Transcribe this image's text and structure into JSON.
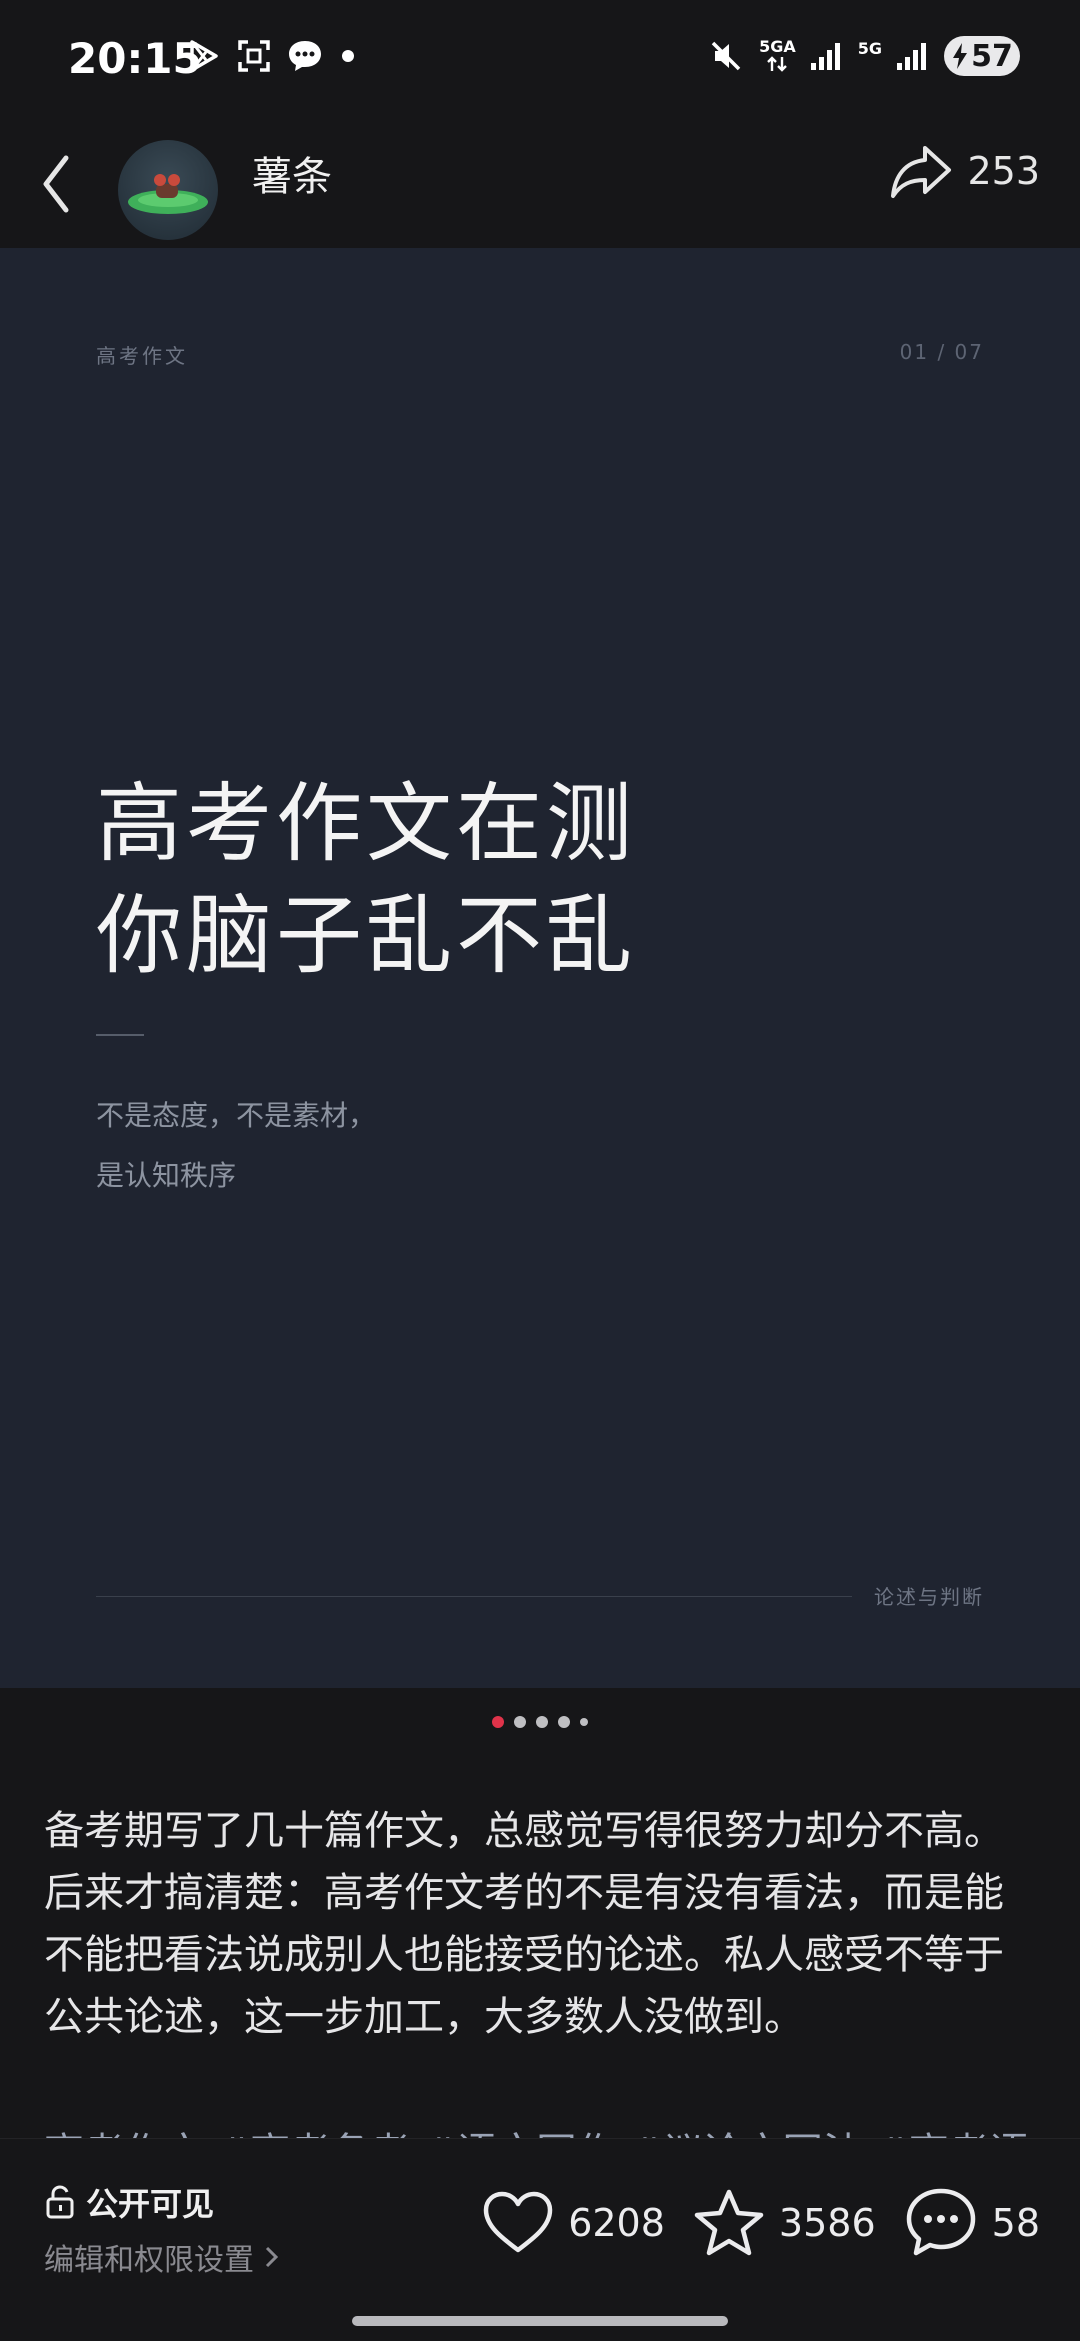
{
  "status_bar": {
    "time": "20:15",
    "icons_left": [
      "play-store-icon",
      "screenshot-icon",
      "message-icon",
      "dot-icon"
    ],
    "network_1": "5GA",
    "network_2": "5G",
    "battery": "57"
  },
  "header": {
    "author": "薯条",
    "share_count": "253"
  },
  "card": {
    "tag": "高考作文",
    "page_indicator": "01 / 07",
    "title_line1": "高考作文在测",
    "title_line2": "你脑子乱不乱",
    "subtitle_line1": "不是态度，不是素材，",
    "subtitle_line2": "是认知秩序",
    "footer": "论述与判断",
    "background_color": "#1f2430"
  },
  "carousel": {
    "total_visible_dots": 5,
    "active_index": 0,
    "active_color": "#e0334a"
  },
  "post": {
    "body": "备考期写了几十篇作文，总感觉写得很努力却分不高。后来才搞清楚：高考作文考的不是有没有看法，而是能不能把看法说成别人也能接受的论述。私人感受不等于公共论述，这一步加工，大多数人没做到。",
    "tags": "高考作文 #高考备考 #语文写作 #议论文写法 #高考语文"
  },
  "bottom_bar": {
    "visibility": "公开可见",
    "permission_link": "编辑和权限设置",
    "likes": "6208",
    "favorites": "3586",
    "comments": "58"
  }
}
